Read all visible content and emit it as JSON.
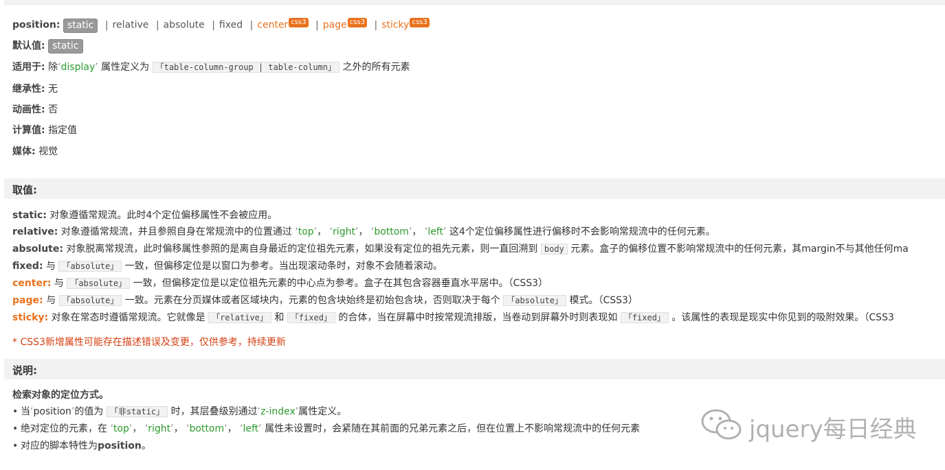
{
  "syntax": {
    "position_label": "position",
    "values": [
      "static",
      "relative",
      "absolute",
      "fixed",
      "center",
      "page",
      "sticky"
    ],
    "css3_badge": "css3",
    "default_label": "默认值",
    "default_value": "static",
    "applies_label": "适用于",
    "applies_pre": "除",
    "applies_prop": "display",
    "applies_mid": "属性定义为",
    "applies_code": "「table-column-group | table-column」",
    "applies_post": "之外的所有元素",
    "inherit_label": "继承性",
    "inherit_value": "无",
    "anim_label": "动画性",
    "anim_value": "否",
    "computed_label": "计算值",
    "computed_value": "指定值",
    "media_label": "媒体",
    "media_value": "视觉"
  },
  "values_section": {
    "title": "取值:",
    "static": "对象遵循常规流。此时4个定位偏移属性不会被应用。",
    "relative_pre": "对象遵循常规流，并且参照自身在常规流中的位置通过",
    "offsets": [
      "top",
      "right",
      "bottom",
      "left"
    ],
    "relative_post": "这4个定位偏移属性进行偏移时不会影响常规流中的任何元素。",
    "absolute_pre": "对象脱离常规流，此时偏移属性参照的是离自身最近的定位祖先元素，如果没有定位的祖先元素，则一直回溯到",
    "body_code": "body",
    "absolute_post": "元素。盒子的偏移位置不影响常规流中的任何元素，其margin不与其他任何ma",
    "with": "与",
    "absolute_code": "「absolute」",
    "fixed_post": "一致，但偏移定位是以窗口为参考。当出现滚动条时，对象不会随着滚动。",
    "center_post": "一致，但偏移定位是以定位祖先元素的中心点为参考。盒子在其包含容器垂直水平居中。（CSS3）",
    "page_mid": "一致。元素在分页媒体或者区域块内，元素的包含块始终是初始包含块，否则取决于每个",
    "page_post": "模式。（CSS3）",
    "sticky_pre": "对象在常态时遵循常规流。它就像是",
    "relative_code": "「relative」",
    "and": "和",
    "fixed_code": "「fixed」",
    "sticky_mid": "的合体，当在屏幕中时按常规流排版，当卷动到屏幕外时则表现如",
    "sticky_post": "。该属性的表现是现实中你见到的吸附效果。（CSS3",
    "note": "* CSS3新增属性可能存在描述错误及变更，仅供参考，持续更新"
  },
  "desc_section": {
    "title": "说明:",
    "lead": "检索对象的定位方式。",
    "b1_pre": "当",
    "b1_prop": "position",
    "b1_mid": "的值为",
    "b1_code": "「非static」",
    "b1_mid2": "时，其层叠级别通过",
    "b1_prop2": "z-index",
    "b1_post": "属性定义。",
    "b2_pre": "绝对定位的元素，在",
    "b2_post": "属性未设置时，会紧随在其前面的兄弟元素之后，但在位置上不影响常规流中的任何元素",
    "b3_pre": "对应的脚本特性为",
    "b3_bold": "position",
    "b3_post": "。"
  },
  "watermark": {
    "text": "jquery每日经典"
  }
}
